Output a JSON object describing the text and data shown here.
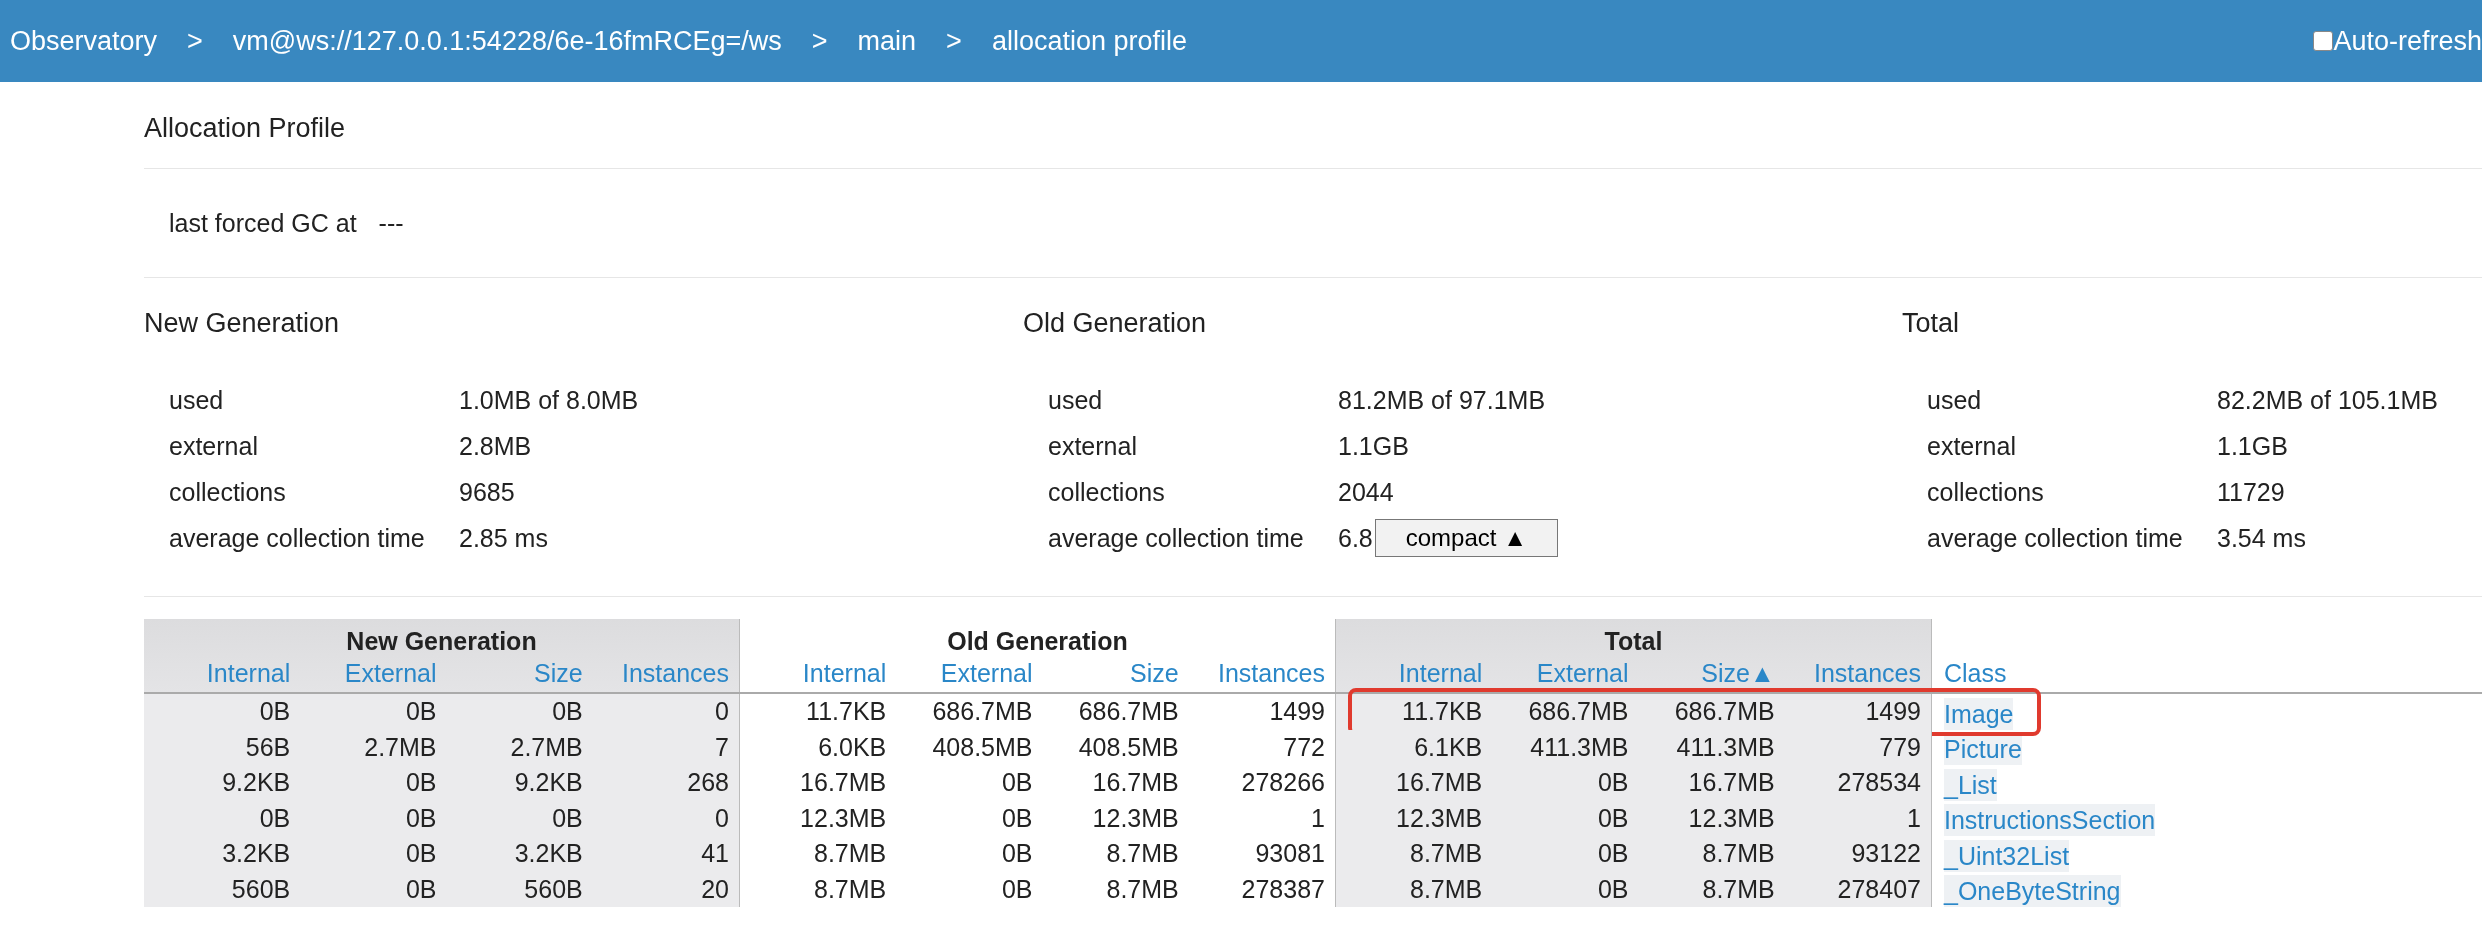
{
  "nav": {
    "crumbs": [
      "Observatory",
      "vm@ws://127.0.0.1:54228/6e-16fmRCEg=/ws",
      "main",
      "allocation profile"
    ],
    "separator": ">",
    "auto_refresh": {
      "label": "Auto-refresh",
      "checked": false
    }
  },
  "title": "Allocation Profile",
  "last_gc": {
    "label": "last forced GC at",
    "value": "---"
  },
  "sections": [
    {
      "title": "New Generation",
      "stats": [
        {
          "label": "used",
          "value": "1.0MB of 8.0MB"
        },
        {
          "label": "external",
          "value": "2.8MB"
        },
        {
          "label": "collections",
          "value": "9685"
        },
        {
          "label": "average collection time",
          "value": "2.85 ms"
        }
      ]
    },
    {
      "title": "Old Generation",
      "stats": [
        {
          "label": "used",
          "value": "81.2MB of 97.1MB"
        },
        {
          "label": "external",
          "value": "1.1GB"
        },
        {
          "label": "collections",
          "value": "2044"
        },
        {
          "label": "average collection time",
          "value": "6.8"
        }
      ],
      "button": "compact ▲"
    },
    {
      "title": "Total",
      "stats": [
        {
          "label": "used",
          "value": "82.2MB of 105.1MB"
        },
        {
          "label": "external",
          "value": "1.1GB"
        },
        {
          "label": "collections",
          "value": "11729"
        },
        {
          "label": "average collection time",
          "value": "3.54 ms"
        }
      ]
    }
  ],
  "table": {
    "groups": [
      {
        "title": "New Generation",
        "shaded": true,
        "columns": [
          {
            "label": "Internal"
          },
          {
            "label": "External"
          },
          {
            "label": "Size"
          },
          {
            "label": "Instances"
          }
        ]
      },
      {
        "title": "Old Generation",
        "shaded": false,
        "columns": [
          {
            "label": "Internal"
          },
          {
            "label": "External"
          },
          {
            "label": "Size"
          },
          {
            "label": "Instances"
          }
        ]
      },
      {
        "title": "Total",
        "shaded": true,
        "columns": [
          {
            "label": "Internal"
          },
          {
            "label": "External"
          },
          {
            "label": "Size",
            "sort_mark": "▲"
          },
          {
            "label": "Instances"
          }
        ]
      }
    ],
    "class_column": "Class",
    "rows": [
      {
        "cells": [
          [
            "0B",
            "0B",
            "0B",
            "0"
          ],
          [
            "11.7KB",
            "686.7MB",
            "686.7MB",
            "1499"
          ],
          [
            "11.7KB",
            "686.7MB",
            "686.7MB",
            "1499"
          ]
        ],
        "class": "Image",
        "highlighted": true
      },
      {
        "cells": [
          [
            "56B",
            "2.7MB",
            "2.7MB",
            "7"
          ],
          [
            "6.0KB",
            "408.5MB",
            "408.5MB",
            "772"
          ],
          [
            "6.1KB",
            "411.3MB",
            "411.3MB",
            "779"
          ]
        ],
        "class": "Picture",
        "highlighted": false
      },
      {
        "cells": [
          [
            "9.2KB",
            "0B",
            "9.2KB",
            "268"
          ],
          [
            "16.7MB",
            "0B",
            "16.7MB",
            "278266"
          ],
          [
            "16.7MB",
            "0B",
            "16.7MB",
            "278534"
          ]
        ],
        "class": "_List",
        "highlighted": false
      },
      {
        "cells": [
          [
            "0B",
            "0B",
            "0B",
            "0"
          ],
          [
            "12.3MB",
            "0B",
            "12.3MB",
            "1"
          ],
          [
            "12.3MB",
            "0B",
            "12.3MB",
            "1"
          ]
        ],
        "class": "InstructionsSection",
        "highlighted": false
      },
      {
        "cells": [
          [
            "3.2KB",
            "0B",
            "3.2KB",
            "41"
          ],
          [
            "8.7MB",
            "0B",
            "8.7MB",
            "93081"
          ],
          [
            "8.7MB",
            "0B",
            "8.7MB",
            "93122"
          ]
        ],
        "class": "_Uint32List",
        "highlighted": false
      },
      {
        "cells": [
          [
            "560B",
            "0B",
            "560B",
            "20"
          ],
          [
            "8.7MB",
            "0B",
            "8.7MB",
            "278387"
          ],
          [
            "8.7MB",
            "0B",
            "8.7MB",
            "278407"
          ]
        ],
        "class": "_OneByteString",
        "highlighted": false
      }
    ]
  }
}
